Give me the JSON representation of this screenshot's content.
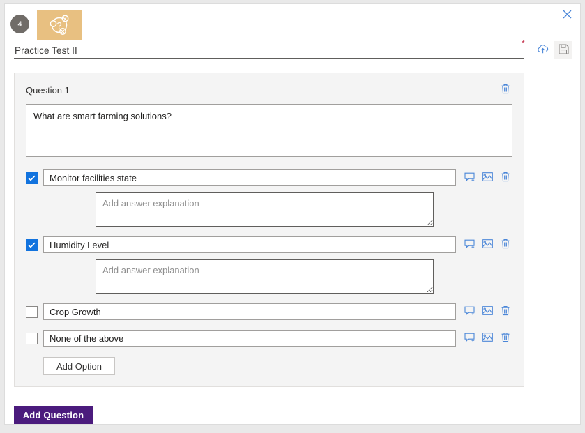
{
  "window": {
    "close_label": "close-icon"
  },
  "header": {
    "badge_number": "4",
    "tile_icon": "quiz-icon",
    "title": "Practice Test II",
    "required_marker": "*",
    "actions": [
      {
        "name": "publish-icon",
        "label": "Publish"
      },
      {
        "name": "save-icon",
        "label": "Save"
      }
    ]
  },
  "question": {
    "label": "Question 1",
    "delete_icon": "trash-icon",
    "text": "What are smart farming solutions?",
    "options": [
      {
        "label": "Monitor facilities state",
        "checked": true,
        "explanation_value": "",
        "explanation_placeholder": "Add answer explanation",
        "has_explanation": true
      },
      {
        "label": "Humidity Level",
        "checked": true,
        "explanation_value": "",
        "explanation_placeholder": "Add answer explanation",
        "has_explanation": true
      },
      {
        "label": "Crop Growth",
        "checked": false,
        "explanation_value": "",
        "explanation_placeholder": "Add answer explanation",
        "has_explanation": false
      },
      {
        "label": "None of the above",
        "checked": false,
        "explanation_value": "",
        "explanation_placeholder": "Add answer explanation",
        "has_explanation": false
      }
    ],
    "option_icons": [
      {
        "name": "add-comment-icon"
      },
      {
        "name": "add-image-icon"
      },
      {
        "name": "trash-icon"
      }
    ],
    "add_option_label": "Add Option"
  },
  "footer": {
    "add_question_label": "Add Question"
  },
  "colors": {
    "accent_purple": "#4b1b7d",
    "tile_tan": "#e8c081",
    "checkbox_blue": "#1273de",
    "icon_blue": "#4a86d8",
    "required_red": "#c4314b",
    "card_bg": "#f4f4f4"
  }
}
